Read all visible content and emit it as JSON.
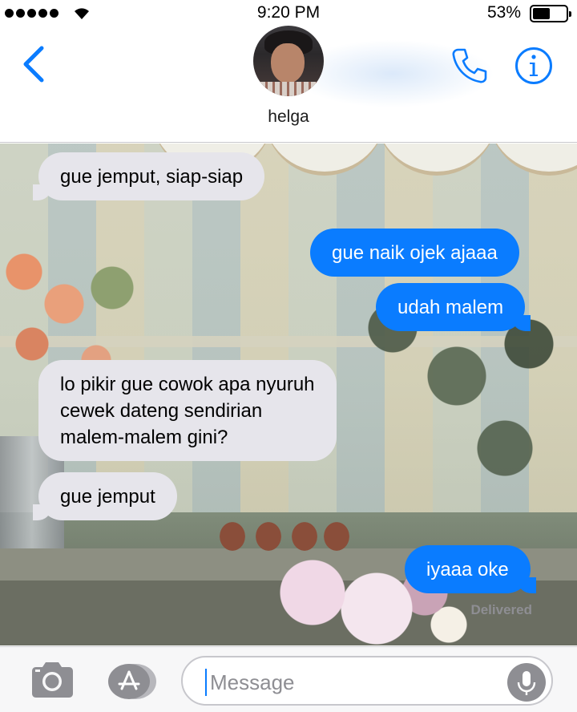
{
  "status_bar": {
    "time": "9:20 PM",
    "battery_percent_label": "53%",
    "battery_level": 0.53,
    "signal_dots": 5,
    "icons": [
      "signal-dots-icon",
      "wifi-icon",
      "battery-icon"
    ]
  },
  "header": {
    "contact_name": "helga",
    "icons": [
      "back-chevron-icon",
      "contact-avatar",
      "phone-icon",
      "info-icon"
    ],
    "accent_color": "#0a7cff"
  },
  "messages": [
    {
      "direction": "received",
      "text": "gue jemput, siap-siap"
    },
    {
      "direction": "sent",
      "text": "gue naik ojek ajaaa"
    },
    {
      "direction": "sent",
      "text": "udah malem"
    },
    {
      "direction": "received",
      "lines": [
        "lo pikir gue cowok apa nyuruh",
        "cewek dateng sendirian",
        "malem-malem gini?"
      ]
    },
    {
      "direction": "received",
      "text": "gue jemput"
    },
    {
      "direction": "sent",
      "text": "iyaaa oke"
    }
  ],
  "delivery_status": "Delivered",
  "composer": {
    "placeholder": "Message",
    "icons": [
      "camera-icon",
      "app-store-icon",
      "microphone-icon"
    ]
  },
  "colors": {
    "sent_bubble": "#0a7cff",
    "received_bubble": "#e6e5eb"
  }
}
